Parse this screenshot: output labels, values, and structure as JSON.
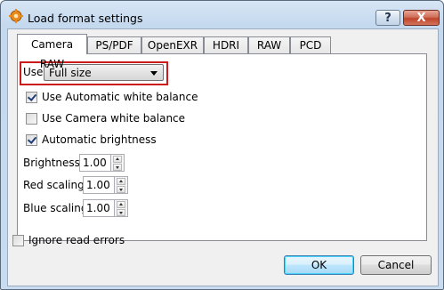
{
  "window": {
    "title": "Load format settings",
    "help_label": "?",
    "close_label": "X"
  },
  "tabs": [
    {
      "label": "Camera RAW",
      "active": true
    },
    {
      "label": "PS/PDF",
      "active": false
    },
    {
      "label": "OpenEXR",
      "active": false
    },
    {
      "label": "HDRI",
      "active": false
    },
    {
      "label": "RAW",
      "active": false
    },
    {
      "label": "PCD",
      "active": false
    }
  ],
  "camera_raw": {
    "use_label": "Use",
    "use_value": "Full size",
    "checkboxes": [
      {
        "label": "Use Automatic white balance",
        "checked": true
      },
      {
        "label": "Use Camera white balance",
        "checked": false
      },
      {
        "label": "Automatic brightness",
        "checked": true
      }
    ],
    "fields": [
      {
        "label": "Brightness",
        "value": "1.00"
      },
      {
        "label": "Red scaling",
        "value": "1.00"
      },
      {
        "label": "Blue scaling",
        "value": "1.00"
      }
    ]
  },
  "ignore_errors": {
    "label": "Ignore read errors",
    "checked": false
  },
  "buttons": {
    "ok": "OK",
    "cancel": "Cancel"
  },
  "colors": {
    "highlight": "#cc1b1b",
    "title_bar": "#c4d8ee",
    "close_button": "#c0432a"
  }
}
